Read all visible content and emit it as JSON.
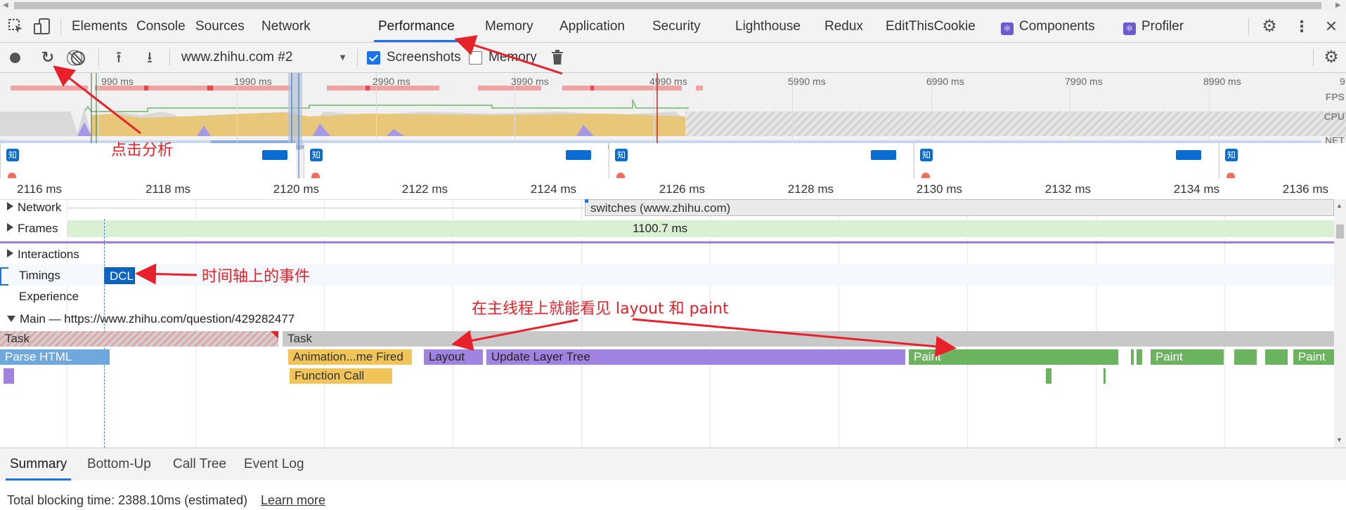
{
  "tabs": {
    "items": [
      "Elements",
      "Console",
      "Sources",
      "Network",
      "Performance",
      "Memory",
      "Application",
      "Security",
      "Lighthouse",
      "Redux",
      "EditThisCookie",
      "Components",
      "Profiler"
    ],
    "active": "Performance"
  },
  "toolbar": {
    "profile_select": "www.zhihu.com #2",
    "screenshots_label": "Screenshots",
    "screenshots_checked": true,
    "memory_label": "Memory",
    "memory_checked": false
  },
  "overview": {
    "ticks": [
      "990 ms",
      "1990 ms",
      "2990 ms",
      "3990 ms",
      "4990 ms",
      "5990 ms",
      "6990 ms",
      "7990 ms",
      "8990 ms",
      "9"
    ],
    "lanes": [
      "FPS",
      "CPU",
      "NET"
    ],
    "screenshot_logo": "知"
  },
  "ruler": {
    "ticks": [
      "2116 ms",
      "2118 ms",
      "2120 ms",
      "2122 ms",
      "2124 ms",
      "2126 ms",
      "2128 ms",
      "2130 ms",
      "2132 ms",
      "2134 ms",
      "2136 ms"
    ]
  },
  "tracks": {
    "network": "Network",
    "network_request": "switches (www.zhihu.com)",
    "frames": "Frames",
    "frame_duration": "1100.7 ms",
    "interactions": "Interactions",
    "timings": "Timings",
    "dcl": "DCL",
    "experience": "Experience",
    "main": "Main — https://www.zhihu.com/question/429282477"
  },
  "main_events": {
    "task1": "Task",
    "task2": "Task",
    "parse_html": "Parse HTML",
    "animation": "Animation...me Fired",
    "layout": "Layout",
    "update_layer_tree": "Update Layer Tree",
    "paint1": "Paint",
    "paint2": "Paint",
    "paint3": "Paint",
    "function_call": "Function Call"
  },
  "bottom": {
    "tabs": [
      "Summary",
      "Bottom-Up",
      "Call Tree",
      "Event Log"
    ],
    "active": "Summary",
    "summary_text": "Total blocking time: 2388.10ms (estimated)",
    "learn_more": "Learn more"
  },
  "annotations": {
    "click_analyze": "点击分析",
    "timeline_events": "时间轴上的事件",
    "main_thread_note": "在主线程上就能看见 layout 和 paint"
  },
  "colors": {
    "accent": "#1a73e8",
    "annotation": "#e8202a",
    "task": "#c8c8c8",
    "parse_html": "#6fa8dc",
    "scripting": "#f0c457",
    "rendering": "#a083e0",
    "painting": "#6bb35f",
    "frames": "#d9f0d3"
  }
}
